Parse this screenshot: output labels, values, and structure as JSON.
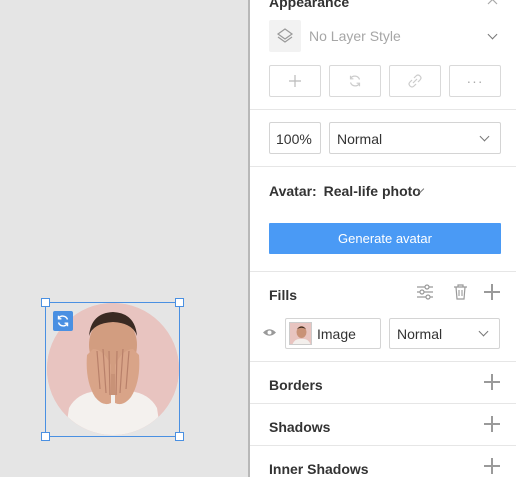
{
  "appearance": {
    "title": "Appearance",
    "layer_style": "No Layer Style",
    "icons": [
      "plus-icon",
      "refresh-icon",
      "unlink-icon",
      "more-icon"
    ],
    "more_label": "···"
  },
  "opacity": {
    "value": "100%"
  },
  "blend": {
    "value": "Normal"
  },
  "avatar_option": {
    "label": "Avatar:",
    "value": "Real-life photo"
  },
  "generate": {
    "label": "Generate avatar"
  },
  "fills": {
    "title": "Fills",
    "item_type": "Image",
    "item_blend": "Normal"
  },
  "sections": {
    "borders": "Borders",
    "shadows": "Shadows",
    "inner_shadows": "Inner Shadows"
  },
  "colors": {
    "accent": "#4a9af5",
    "selection": "#4a90e2",
    "avatar_bg": "#e8c4c0"
  }
}
